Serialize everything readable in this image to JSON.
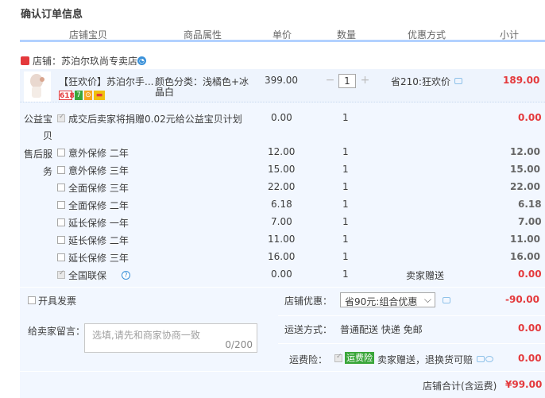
{
  "page_title": "确认订单信息",
  "columns": [
    "店铺宝贝",
    "商品属性",
    "单价",
    "数量",
    "优惠方式",
    "小计"
  ],
  "shop": {
    "label": "店铺：",
    "name": "苏泊尔玖尚专卖店"
  },
  "item": {
    "name": "【狂欢价】苏泊尔手...",
    "attr_line1": "颜色分类：浅橘色+冰",
    "attr_line2": "晶白",
    "price": "399.00",
    "qty": "1",
    "promo": "省210:狂欢价",
    "subtotal": "189.00",
    "tags": [
      "618",
      "7",
      "⊙",
      "▬"
    ]
  },
  "charity": {
    "label_line1": "公益宝",
    "label_line2": "贝",
    "text": "成交后卖家将捐赠0.02元给公益宝贝计划",
    "price": "0.00",
    "qty": "1",
    "subtotal": "0.00"
  },
  "services": {
    "label_line1": "售后服",
    "label_line2": "务",
    "items": [
      {
        "name": "意外保修 二年",
        "price": "12.00",
        "qty": "1",
        "promo": "",
        "subtotal": "12.00"
      },
      {
        "name": "意外保修 三年",
        "price": "15.00",
        "qty": "1",
        "promo": "",
        "subtotal": "15.00"
      },
      {
        "name": "全面保修 三年",
        "price": "22.00",
        "qty": "1",
        "promo": "",
        "subtotal": "22.00"
      },
      {
        "name": "全面保修 二年",
        "price": "6.18",
        "qty": "1",
        "promo": "",
        "subtotal": "6.18"
      },
      {
        "name": "延长保修 一年",
        "price": "7.00",
        "qty": "1",
        "promo": "",
        "subtotal": "7.00"
      },
      {
        "name": "延长保修 二年",
        "price": "11.00",
        "qty": "1",
        "promo": "",
        "subtotal": "11.00"
      },
      {
        "name": "延长保修 三年",
        "price": "16.00",
        "qty": "1",
        "promo": "",
        "subtotal": "16.00"
      },
      {
        "name": "全国联保",
        "price": "0.00",
        "qty": "1",
        "promo": "卖家赠送",
        "subtotal": "0.00"
      }
    ]
  },
  "invoice_label": "开具发票",
  "shop_discount": {
    "label": "店铺优惠：",
    "selected": "省90元:组合优惠",
    "amount": "-90.00"
  },
  "delivery": {
    "label": "运送方式：",
    "value": "普通配送 快递 免邮",
    "amount": "0.00"
  },
  "message": {
    "label": "给卖家留言：",
    "placeholder": "选填,请先和商家协商一致",
    "counter": "0/200"
  },
  "insurance": {
    "label": "运费险：",
    "badge": "运费险",
    "text": "卖家赠送，退换货可赔",
    "amount": "0.00"
  },
  "total": {
    "label": "店铺合计(含运费)",
    "amount": "¥99.00"
  },
  "colors": {
    "accent_red": "#e4393c",
    "panel_bg": "#f2f7ff",
    "header_line": "#b2d1ff",
    "green": "#3aa63a"
  }
}
